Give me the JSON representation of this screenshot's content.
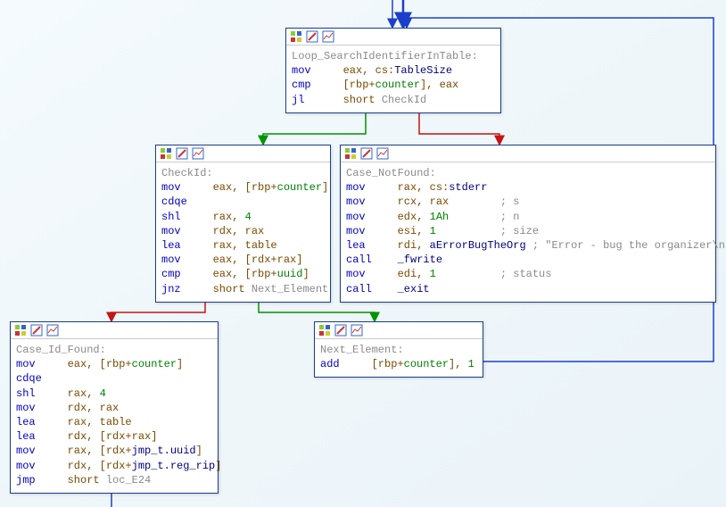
{
  "blocks": {
    "loop": {
      "label": "Loop_SearchIdentifierInTable:",
      "lines": [
        {
          "m": "mov",
          "o": "eax, cs:TableSize"
        },
        {
          "m": "cmp",
          "o": "[rbp+",
          "k": "counter",
          "o2": "], eax"
        },
        {
          "m": "jl",
          "o": "short ",
          "t": "CheckId"
        }
      ]
    },
    "checkid": {
      "label": "CheckId:",
      "lines": [
        {
          "m": "mov",
          "o": "eax, [rbp+",
          "k": "counter",
          "o2": "]"
        },
        {
          "m": "cdqe",
          "o": ""
        },
        {
          "m": "shl",
          "o": "rax, ",
          "n": "4"
        },
        {
          "m": "mov",
          "o": "rdx, rax"
        },
        {
          "m": "lea",
          "o": "rax, table"
        },
        {
          "m": "mov",
          "o": "eax, [rdx+rax]"
        },
        {
          "m": "cmp",
          "o": "eax, [rbp+",
          "k": "uuid",
          "o2": "]"
        },
        {
          "m": "jnz",
          "o": "short ",
          "t": "Next_Element"
        }
      ]
    },
    "notfound": {
      "label": "Case_NotFound:",
      "lines": [
        {
          "m": "mov",
          "o": "rax, cs:",
          "sym": "stderr"
        },
        {
          "m": "mov",
          "o": "rcx, rax",
          "c": "; s"
        },
        {
          "m": "mov",
          "o": "edx, ",
          "n": "1Ah",
          "c": "; n"
        },
        {
          "m": "mov",
          "o": "esi, ",
          "n": "1",
          "c": "; size"
        },
        {
          "m": "lea",
          "o": "rdi, ",
          "sym": "aErrorBugTheOrg",
          "c": "; \"Error - bug the organizer\\n\""
        },
        {
          "m": "call",
          "o": "_fwrite"
        },
        {
          "m": "mov",
          "o": "edi, ",
          "n": "1",
          "c": "; status"
        },
        {
          "m": "call",
          "o": "_exit"
        }
      ]
    },
    "found": {
      "label": "Case_Id_Found:",
      "lines": [
        {
          "m": "mov",
          "o": "eax, [rbp+",
          "k": "counter",
          "o2": "]"
        },
        {
          "m": "cdqe",
          "o": ""
        },
        {
          "m": "shl",
          "o": "rax, ",
          "n": "4"
        },
        {
          "m": "mov",
          "o": "rdx, rax"
        },
        {
          "m": "lea",
          "o": "rax, table"
        },
        {
          "m": "lea",
          "o": "rdx, [rdx+rax]"
        },
        {
          "m": "mov",
          "o": "rax, [rdx+",
          "sym": "jmp_t.uuid",
          "o2": "]"
        },
        {
          "m": "mov",
          "o": "rdx, [rdx+",
          "sym": "jmp_t.reg_rip",
          "o2": "]"
        },
        {
          "m": "jmp",
          "o": "short ",
          "t": "loc_E24"
        }
      ]
    },
    "next": {
      "label": "Next_Element:",
      "lines": [
        {
          "m": "add",
          "o": "[rbp+",
          "k": "counter",
          "o2": "], ",
          "n": "1"
        }
      ]
    }
  },
  "icons": {
    "i1": "palette-icon",
    "i2": "edit-icon",
    "i3": "graph-icon"
  }
}
